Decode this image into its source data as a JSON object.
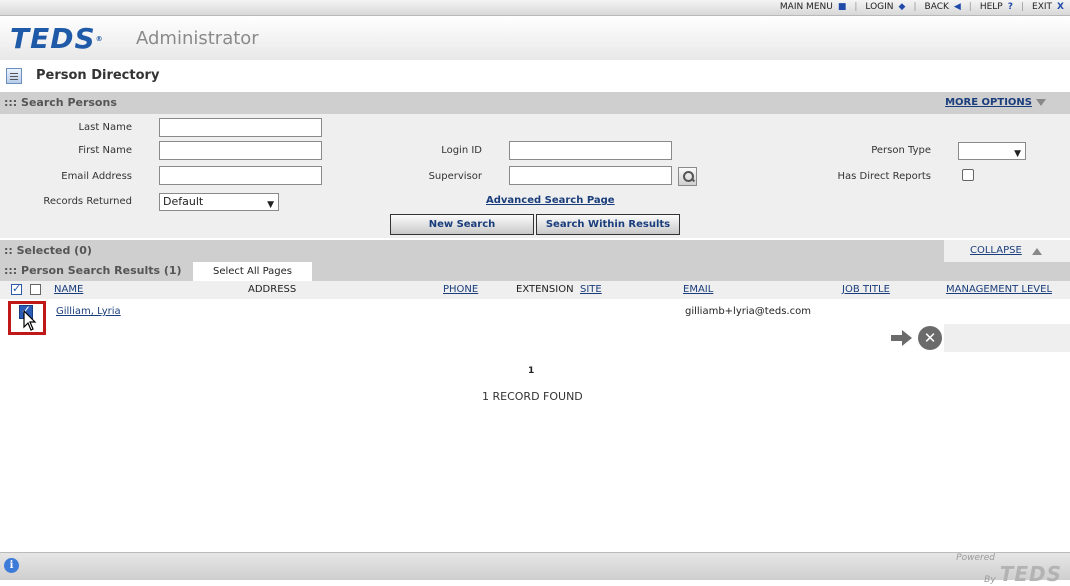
{
  "topnav": {
    "main_menu": "MAIN MENU",
    "login": "LOGIN",
    "back": "BACK",
    "help": "HELP",
    "exit": "EXIT"
  },
  "header": {
    "logo": "TEDS",
    "logo_reg": "®",
    "subtitle": "Administrator"
  },
  "page": {
    "title": "Person Directory"
  },
  "search": {
    "section_title": "::: Search Persons",
    "more_options": "MORE OPTIONS",
    "last_name_label": "Last Name",
    "first_name_label": "First Name",
    "email_label": "Email Address",
    "records_label": "Records Returned",
    "records_value": "Default",
    "login_id_label": "Login ID",
    "supervisor_label": "Supervisor",
    "person_type_label": "Person Type",
    "person_type_value": "",
    "direct_reports_label": "Has Direct Reports",
    "advanced": "Advanced Search Page",
    "new_search": "New Search",
    "search_within": "Search Within Results"
  },
  "selected": {
    "title": ":: Selected (0)",
    "collapse": "COLLAPSE"
  },
  "results": {
    "title": "::: Person Search Results (1)",
    "select_all": "Select All Pages",
    "columns": {
      "name": "NAME",
      "address": "ADDRESS",
      "phone": "PHONE",
      "extension": "EXTENSION",
      "site": "SITE",
      "email": "EMAIL",
      "job_title": "JOB TITLE",
      "management_level": "MANAGEMENT LEVEL"
    },
    "rows": [
      {
        "name": "Gilliam, Lyria",
        "email": "gilliamb+lyria@teds.com",
        "checked": true
      }
    ],
    "page": "1",
    "record_count": "1  RECORD FOUND"
  },
  "footer": {
    "powered": "Powered",
    "by": "By",
    "brand": "TEDS"
  },
  "colors": {
    "brand_blue": "#1f5aa8",
    "link": "#1a3d7c",
    "highlight": "#c01818",
    "section_bar": "#cfcfcf"
  }
}
